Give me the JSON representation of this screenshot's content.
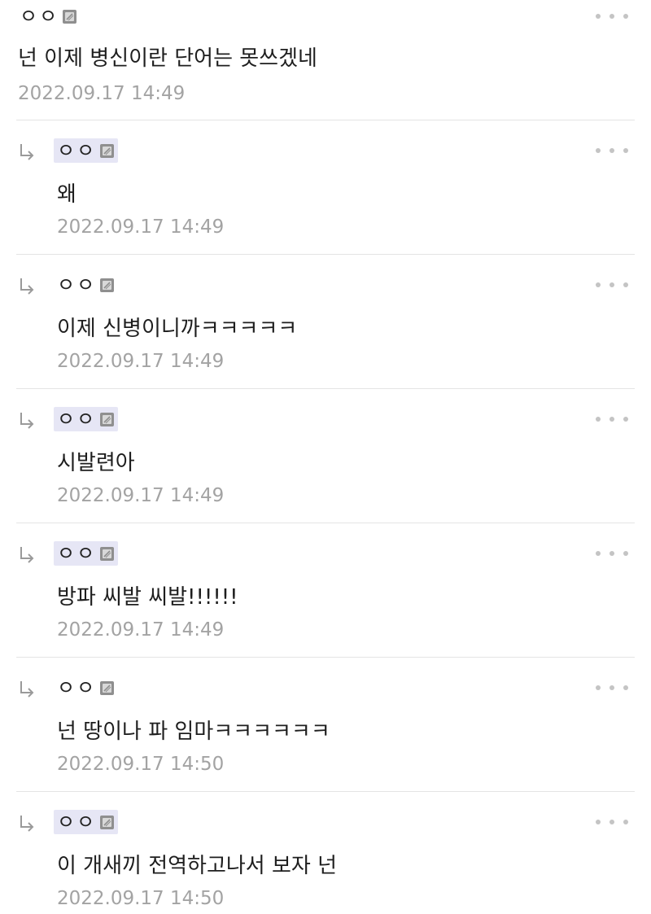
{
  "root_comment": {
    "author": "ㅇㅇ",
    "author_icon": "gallery-member-icon",
    "text": "넌 이제 병신이란 단어는 못쓰겠네",
    "timestamp": "2022.09.17 14:49"
  },
  "replies": [
    {
      "author": "ㅇㅇ",
      "author_highlighted": true,
      "author_icon": "gallery-member-icon",
      "text": "왜",
      "timestamp": "2022.09.17 14:49"
    },
    {
      "author": "ㅇㅇ",
      "author_highlighted": false,
      "author_icon": "gallery-member-icon",
      "text": "이제 신병이니까ㅋㅋㅋㅋㅋ",
      "timestamp": "2022.09.17 14:49"
    },
    {
      "author": "ㅇㅇ",
      "author_highlighted": true,
      "author_icon": "gallery-member-icon",
      "text": "시발련아",
      "timestamp": "2022.09.17 14:49"
    },
    {
      "author": "ㅇㅇ",
      "author_highlighted": true,
      "author_icon": "gallery-member-icon",
      "text": "방파 씨발 씨발!!!!!!",
      "timestamp": "2022.09.17 14:49"
    },
    {
      "author": "ㅇㅇ",
      "author_highlighted": false,
      "author_icon": "gallery-member-icon",
      "text": "넌 땅이나 파 임마ㅋㅋㅋㅋㅋㅋ",
      "timestamp": "2022.09.17 14:50"
    },
    {
      "author": "ㅇㅇ",
      "author_highlighted": true,
      "author_icon": "gallery-member-icon",
      "text": "이 개새끼 전역하고나서 보자 넌",
      "timestamp": "2022.09.17 14:50"
    }
  ],
  "colors": {
    "author_highlight": "#e6e6f5",
    "timestamp": "#a3a3a3",
    "divider": "#e4e4e4",
    "more_dots": "#c4c4c4"
  },
  "icons": {
    "reply": "reply-arrow-icon",
    "more": "more-options-icon"
  }
}
